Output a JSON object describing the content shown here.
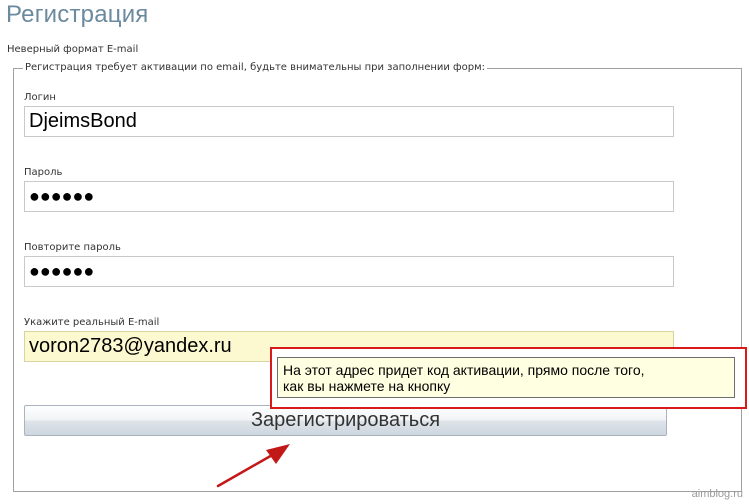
{
  "page": {
    "title": "Регистрация",
    "error": "Неверный формат E-mail",
    "legend": "Регистрация требует активации по email, будьте внимательны при заполнении форм:"
  },
  "form": {
    "login": {
      "label": "Логин",
      "value": "DjeimsBond"
    },
    "password": {
      "label": "Пароль",
      "value": "●●●●●●"
    },
    "password_repeat": {
      "label": "Повторите пароль",
      "value": "●●●●●●"
    },
    "email": {
      "label": "Укажите реальный E-mail",
      "value": "voron2783@yandex.ru"
    },
    "submit_label": "Зарегистрироваться"
  },
  "tooltip": {
    "line1": "На этот адрес придет код активации, прямо после того,",
    "line2": "как вы нажмете на кнопку"
  },
  "watermark": "aimblog.ru",
  "colors": {
    "title": "#6b8a9e",
    "focused_field": "#fcf8cf",
    "tooltip_bg": "#ffffe1",
    "highlight": "#d81a1a"
  }
}
